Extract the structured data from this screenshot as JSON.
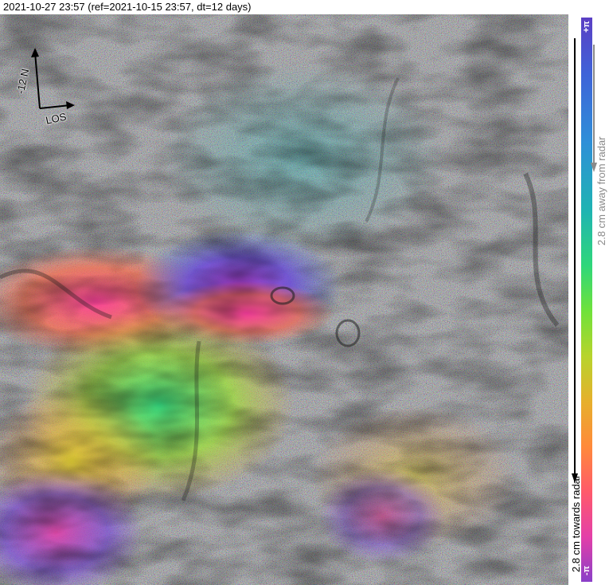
{
  "title": "2021-10-27 23:57 (ref=2021-10-15 23:57, dt=12 days)",
  "compass": {
    "north_label": "-12 N",
    "los_label": "LOS"
  },
  "colorbar": {
    "top_label": "+π",
    "bottom_label": "-π",
    "away_label": "2.8 cm away from radar",
    "towards_label": "2.8 cm towards radar"
  },
  "colors": {
    "background": "#ffffff",
    "terrain_gray": "#7c7f86"
  },
  "icons": [
    "north-arrow-icon",
    "los-arrow-icon",
    "direction-arrow-icon"
  ]
}
